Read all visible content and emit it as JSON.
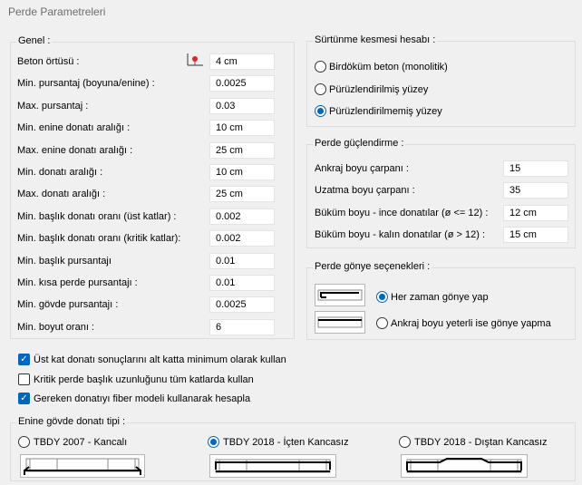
{
  "window": {
    "title": "Perde Parametreleri"
  },
  "genel": {
    "title": "Genel :",
    "rows": [
      {
        "label": "Beton örtüsü :",
        "value": "4 cm"
      },
      {
        "label": "Min.  pursantaj (boyuna/enine) :",
        "value": "0.0025"
      },
      {
        "label": "Max. pursantaj :",
        "value": "0.03"
      },
      {
        "label": "Min. enine donatı aralığı :",
        "value": "10 cm"
      },
      {
        "label": "Max. enine donatı aralığı :",
        "value": "25 cm"
      },
      {
        "label": "Min. donatı aralığı :",
        "value": "10 cm"
      },
      {
        "label": "Max. donatı aralığı :",
        "value": "25 cm"
      },
      {
        "label": "Min. başlık donatı oranı (üst katlar) :",
        "value": "0.002"
      },
      {
        "label": "Min. başlık donatı oranı (kritik katlar):",
        "value": "0.002"
      },
      {
        "label": "Min. başlık pursantajı",
        "value": "0.01"
      },
      {
        "label": "Min. kısa perde pursantajı :",
        "value": "0.01"
      },
      {
        "label": "Min. gövde pursantajı :",
        "value": "0.0025"
      },
      {
        "label": "Min. boyut oranı :",
        "value": "6"
      }
    ]
  },
  "surtunme": {
    "title": "Sürtünme kesmesi hesabı :",
    "options": [
      {
        "label": "Birdöküm beton (monolitik)",
        "selected": false
      },
      {
        "label": "Pürüzlendirilmiş yüzey",
        "selected": false
      },
      {
        "label": "Pürüzlendirilmemiş yüzey",
        "selected": true
      }
    ]
  },
  "guclendirme": {
    "title": "Perde güçlendirme :",
    "rows": [
      {
        "label": "Ankraj boyu çarpanı :",
        "value": "15"
      },
      {
        "label": "Uzatma boyu çarpanı :",
        "value": "35"
      },
      {
        "label": "Büküm boyu - ince donatılar (ø <= 12) :",
        "value": "12 cm"
      },
      {
        "label": "Büküm boyu - kalın donatılar (ø > 12) :",
        "value": "15 cm"
      }
    ]
  },
  "gonye": {
    "title": "Perde gönye seçenekleri :",
    "options": [
      {
        "label": "Her zaman gönye yap",
        "selected": true
      },
      {
        "label": "Ankraj boyu yeterli ise gönye yapma",
        "selected": false
      }
    ]
  },
  "checks": [
    {
      "label": "Üst kat donatı sonuçlarını alt katta minimum olarak kullan",
      "checked": true
    },
    {
      "label": "Kritik perde başlık uzunluğunu tüm katlarda kullan",
      "checked": false
    },
    {
      "label": "Gereken donatıyı fiber modeli kullanarak hesapla",
      "checked": true
    }
  ],
  "enine": {
    "title": "Enine gövde donatı tipi :",
    "options": [
      {
        "label": "TBDY 2007 - Kancalı",
        "selected": false
      },
      {
        "label": "TBDY 2018 - İçten Kancasız",
        "selected": true
      },
      {
        "label": "TBDY 2018 - Dıştan Kancasız",
        "selected": false
      }
    ]
  },
  "colors": {
    "accent": "#0067c0",
    "rebar_marker": "#d9262c"
  }
}
